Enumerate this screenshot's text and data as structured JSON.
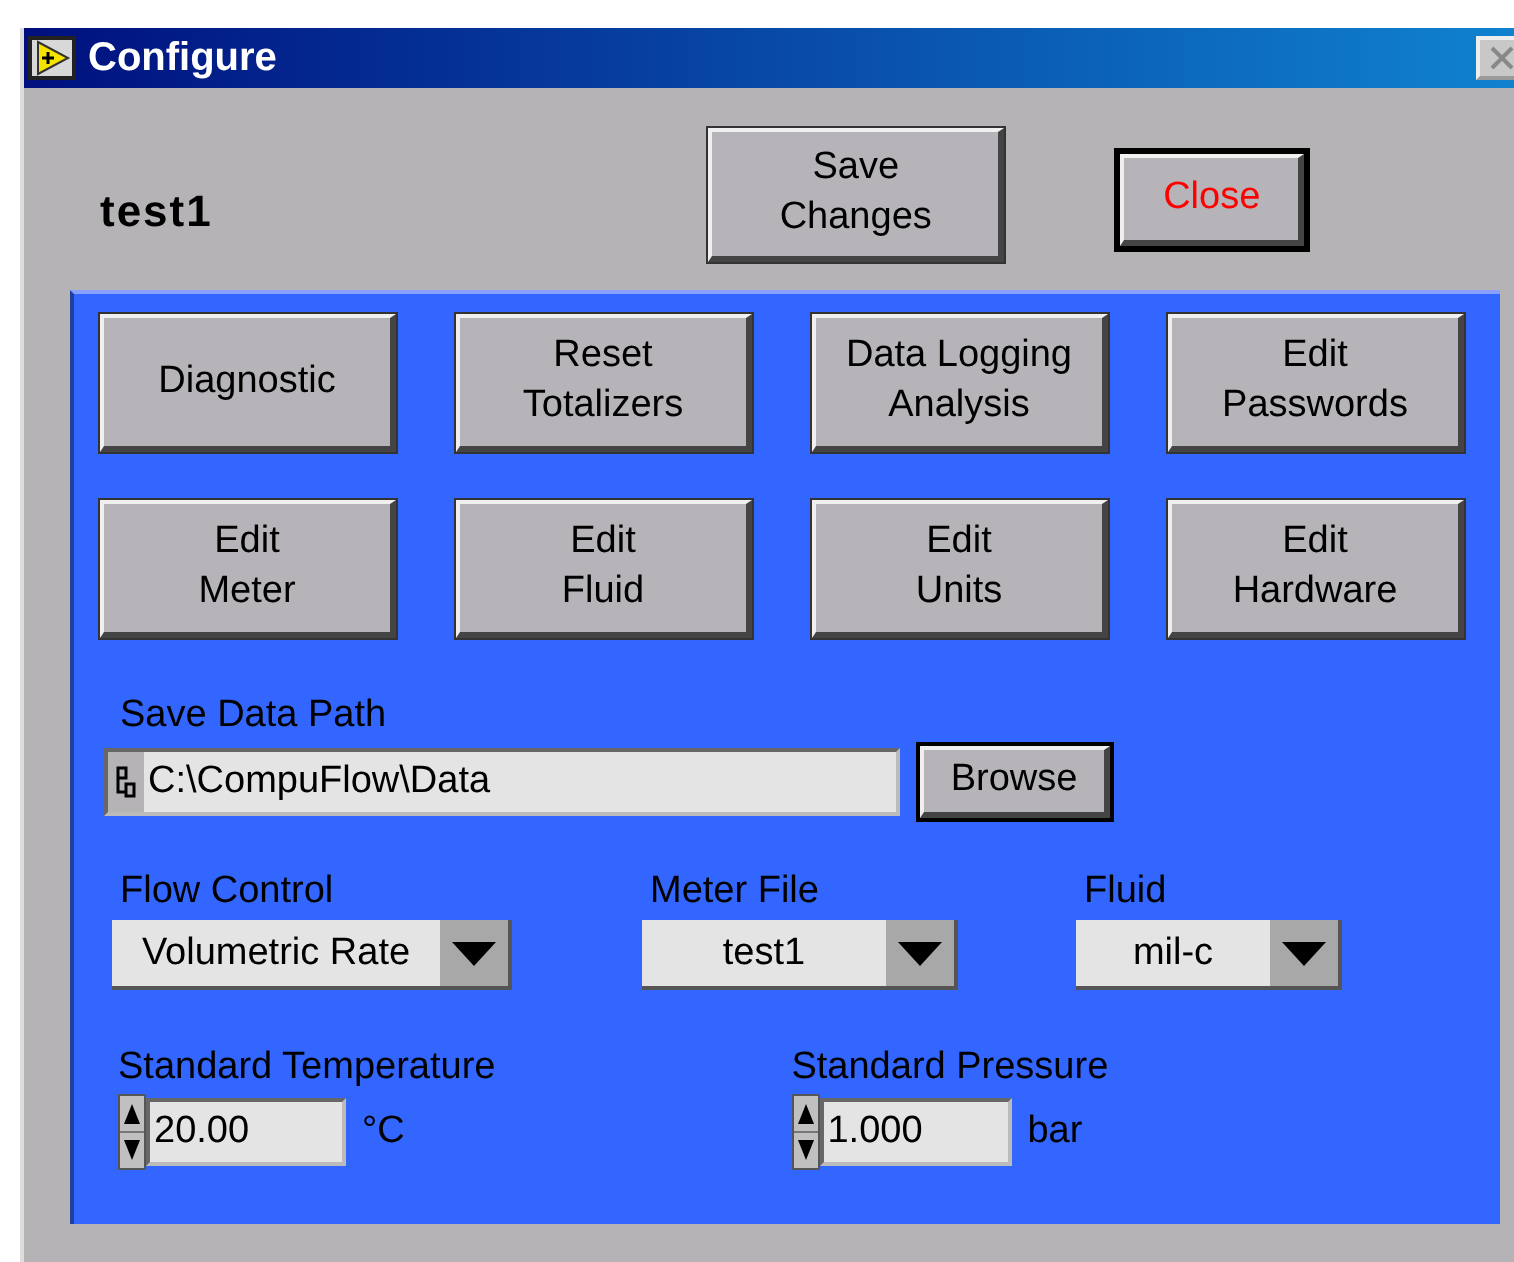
{
  "window": {
    "title": "Configure"
  },
  "header": {
    "name": "test1",
    "buttons": [
      {
        "label": "Save\nChanges",
        "default": false
      },
      {
        "label": "Close",
        "default": true
      }
    ]
  },
  "actions": [
    {
      "label": "Diagnostic"
    },
    {
      "label": "Reset\nTotalizers"
    },
    {
      "label": "Data Logging\nAnalysis"
    },
    {
      "label": "Edit\nPasswords"
    },
    {
      "label": "Edit\nMeter"
    },
    {
      "label": "Edit\nFluid"
    },
    {
      "label": "Edit\nUnits"
    },
    {
      "label": "Edit\nHardware"
    }
  ],
  "save_data_path": {
    "label": "Save Data Path",
    "value": "C:\\CompuFlow\\Data",
    "button": "Browse"
  },
  "dropdowns": [
    {
      "label": "Flow Control",
      "value": "Volumetric Rate"
    },
    {
      "label": "Meter File",
      "value": "test1"
    },
    {
      "label": "Fluid",
      "value": "mil-c"
    }
  ],
  "numerics": [
    {
      "label": "Standard Temperature",
      "value": "20.00",
      "unit": "°C"
    },
    {
      "label": "Standard Pressure",
      "value": "1.000",
      "unit": "bar"
    }
  ]
}
